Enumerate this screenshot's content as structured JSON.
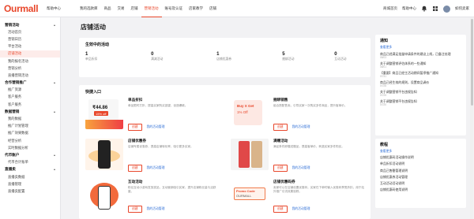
{
  "topbar": {
    "logo": "Ourmall",
    "help": "帮助中心",
    "nav": [
      "我的选款库",
      "商品",
      "交易",
      "店铺",
      "营销活动",
      "账号及认证",
      "店家教学",
      "店铺"
    ],
    "active_index": 4,
    "links": [
      "商城首页",
      "帮助中心"
    ],
    "user": "如何卖家"
  },
  "sidebar": {
    "groups": [
      {
        "title": "营销活动",
        "items": [
          "活动首页",
          "营销日历",
          "平台活动",
          "店铺活动",
          "我的报名活动",
          "营销分析",
          "直播营销活动"
        ],
        "active_item": 3
      },
      {
        "title": "合作营销推广",
        "items": [
          "推广资源",
          "客户服务",
          "客户服务"
        ]
      },
      {
        "title": "数据营销",
        "items": [
          "我的数据",
          "推广计划管理",
          "推广效果数据",
          "经营分析",
          "实时数据分析"
        ]
      },
      {
        "title": "代币账户",
        "items": [
          "代币合计账单"
        ]
      },
      {
        "title": "直播卖",
        "items": [
          "直播卖数据",
          "直播管理",
          "直播卖配置"
        ]
      }
    ]
  },
  "main": {
    "title": "店铺活动",
    "status": {
      "heading": "生效中的活动",
      "stats": [
        {
          "value": "1",
          "label": "单品折扣"
        },
        {
          "value": "0",
          "label": "满减活动"
        },
        {
          "value": "1",
          "label": "店铺优惠券"
        },
        {
          "value": "5",
          "label": "捆绑活动"
        },
        {
          "value": "0",
          "label": "互动活动"
        }
      ]
    },
    "quick": {
      "heading": "快捷入口",
      "create_label": "创建",
      "tiles": [
        {
          "name": "单品折扣",
          "desc": "单品限时打折，提高买家购买欲望，创造爆款。",
          "link": "我的活动管理"
        },
        {
          "name": "捆绑销售",
          "desc": "组合搭配售卖，引导买家一次购买多件商品，提升客单价。",
          "link": "我的活动管理"
        },
        {
          "name": "店铺优惠券",
          "desc": "店铺专属优惠券，提高店铺转化率，吸引更多买家。",
          "link": "我的活动管理"
        },
        {
          "name": "满赠活动",
          "desc": "满足条件即赠送赠品，提高客单价，刺激买家多件购买。",
          "link": "我的活动管理"
        },
        {
          "name": "互动活动",
          "desc": "粉丝互动小游戏发放奖品，互动营销吸引买家，提升店铺粉丝量与活跃度。",
          "link": "我的活动管理"
        },
        {
          "name": "店铺优惠码券",
          "desc": "卖家可以在店铺设置优惠码，买家在下单时输入优惠码享受折扣，用于站外推广引流效果追踪。",
          "link": "我的活动管理"
        }
      ],
      "thumb_text": {
        "price": "₹44.86",
        "tag": "15% off",
        "bogo1": "Buy X Get",
        "bogo2": "1% Off",
        "promo": "Promo Code",
        "promo_sub": "OURMALL"
      }
    }
  },
  "notice": {
    "heading": "通知",
    "more": "查看更多",
    "items": [
      {
        "title": "商品已经满足批量申请条件的建议上线，已备注处理",
        "date": "08/03"
      },
      {
        "title": "关于调整营销评估体系的一些通知",
        "date": "08/01"
      },
      {
        "title": "【重要】商品已经主活动期间暂停推广通知",
        "date": "07/31"
      },
      {
        "title": "商品已经生效的规则，设置商品调价",
        "date": "07/28"
      },
      {
        "title": "关于调整营销平台违规告知",
        "date": "07/25"
      },
      {
        "title": "关于调整营销平台违规告知",
        "date": "07/20"
      }
    ]
  },
  "guide": {
    "heading": "教程",
    "more": "查看更多",
    "items": [
      "店铺优惠码活动操作说明",
      "单品折扣活动说明",
      "商品已售罄管理说明",
      "店铺优惠券活动管理",
      "互动活动活动说明",
      "店铺优惠码使用说明"
    ]
  }
}
